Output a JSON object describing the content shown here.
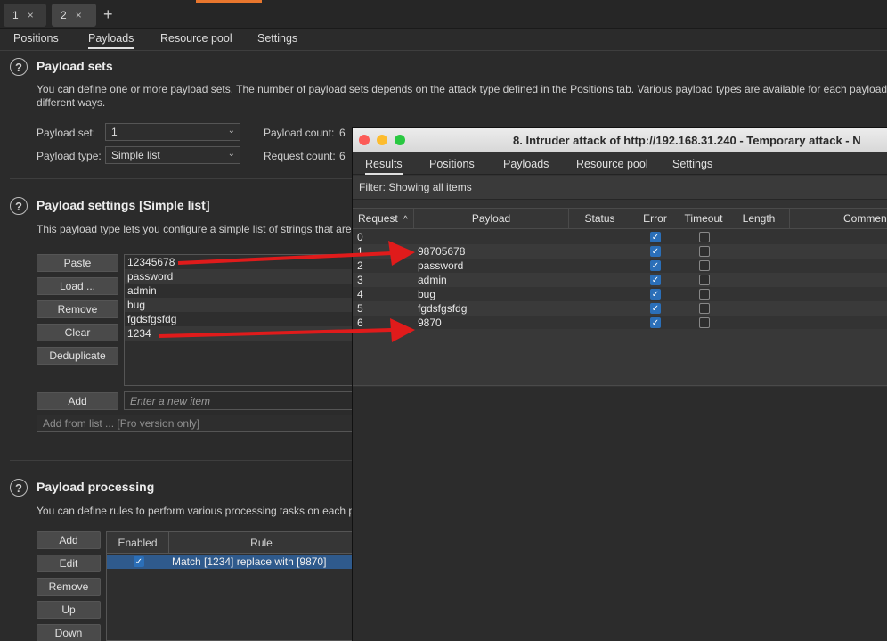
{
  "top_tabs": [
    {
      "label": "1",
      "close": "×"
    },
    {
      "label": "2",
      "close": "×"
    }
  ],
  "add_tab": "+",
  "sub_tabs": [
    "Positions",
    "Payloads",
    "Resource pool",
    "Settings"
  ],
  "payload_sets": {
    "help": "?",
    "title": "Payload sets",
    "description": "You can define one or more payload sets. The number of payload sets depends on the attack type defined in the Positions tab. Various payload types are available for each payload s",
    "description2": "different ways.",
    "set_label": "Payload set:",
    "set_value": "1",
    "type_label": "Payload type:",
    "type_value": "Simple list",
    "count_label": "Payload count:",
    "count_value": "6",
    "request_label": "Request count:",
    "request_value": "6"
  },
  "payload_settings": {
    "help": "?",
    "title": "Payload settings [Simple list]",
    "description": "This payload type lets you configure a simple list of strings that are",
    "buttons": [
      "Paste",
      "Load ...",
      "Remove",
      "Clear",
      "Deduplicate"
    ],
    "items": [
      "12345678",
      "password",
      "admin",
      "bug",
      "fgdsfgsfdg",
      "1234"
    ],
    "add_button": "Add",
    "add_placeholder": "Enter a new item",
    "add_from_list": "Add from list ... [Pro version only]"
  },
  "payload_processing": {
    "help": "?",
    "title": "Payload processing",
    "description": "You can define rules to perform various processing tasks on each p",
    "buttons": [
      "Add",
      "Edit",
      "Remove",
      "Up",
      "Down"
    ],
    "columns": [
      "Enabled",
      "Rule"
    ],
    "rules": [
      {
        "enabled": true,
        "rule": "Match [1234] replace with [9870]"
      }
    ]
  },
  "attack_window": {
    "title": "8. Intruder attack of http://192.168.31.240 - Temporary attack - N",
    "tabs": [
      "Results",
      "Positions",
      "Payloads",
      "Resource pool",
      "Settings"
    ],
    "filter": "Filter: Showing all items",
    "columns": [
      "Request",
      "Payload",
      "Status",
      "Error",
      "Timeout",
      "Length",
      "Commen"
    ],
    "sort_indicator": "^",
    "rows": [
      {
        "request": "0",
        "payload": "",
        "error": true,
        "timeout": false
      },
      {
        "request": "1",
        "payload": "98705678",
        "error": true,
        "timeout": false
      },
      {
        "request": "2",
        "payload": "password",
        "error": true,
        "timeout": false
      },
      {
        "request": "3",
        "payload": "admin",
        "error": true,
        "timeout": false
      },
      {
        "request": "4",
        "payload": "bug",
        "error": true,
        "timeout": false
      },
      {
        "request": "5",
        "payload": "fgdsfgsfdg",
        "error": true,
        "timeout": false
      },
      {
        "request": "6",
        "payload": "9870",
        "error": true,
        "timeout": false
      }
    ]
  },
  "colors": {
    "accent": "#e8762d",
    "arrow": "#e01b1b",
    "checkbox": "#2b6fb8"
  }
}
